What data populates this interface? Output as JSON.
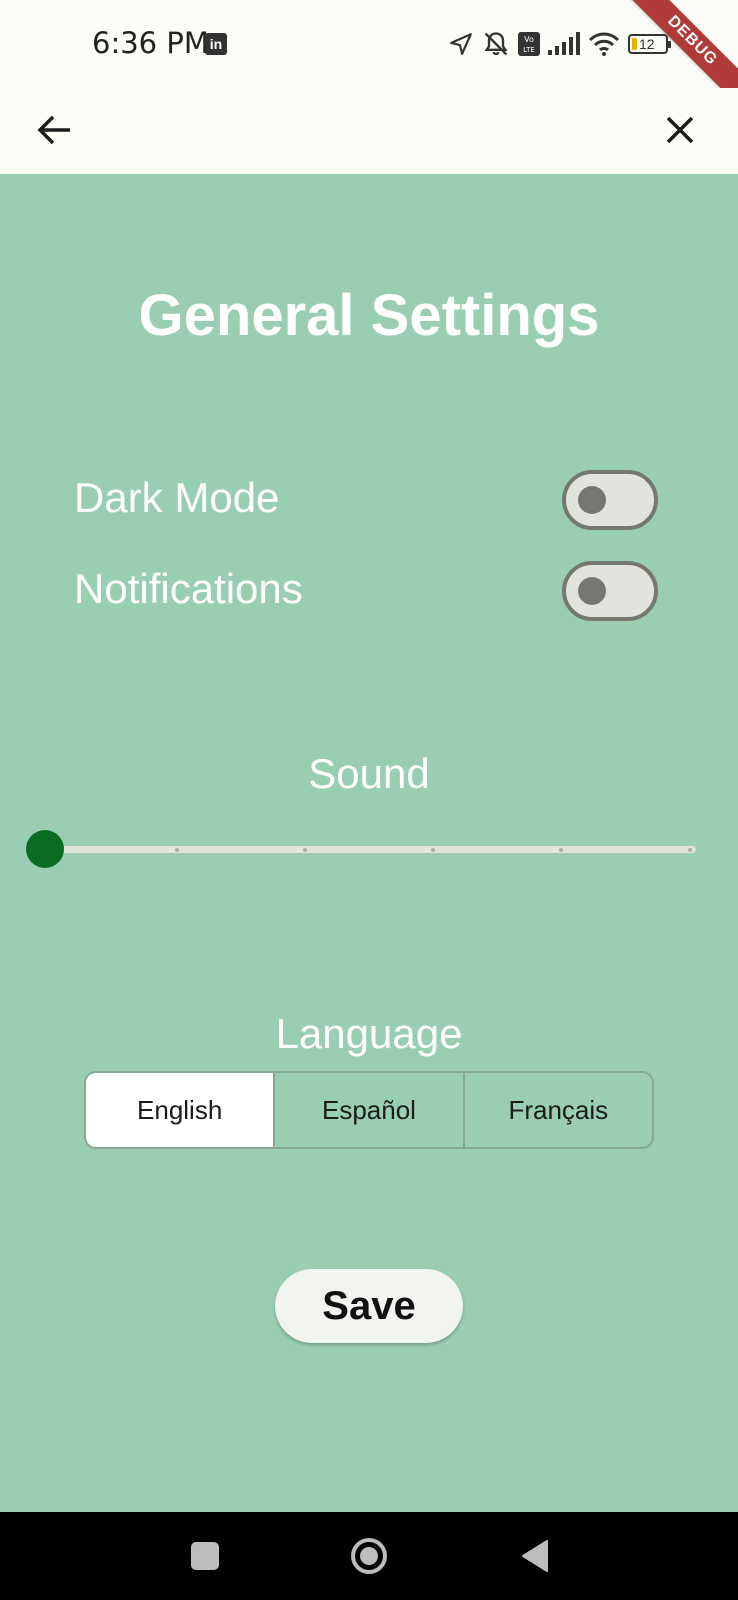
{
  "status_bar": {
    "time": "6:36 PM",
    "linkedin_icon_label": "in",
    "battery_level": "12",
    "icons": [
      "linkedin-icon",
      "location-arrow-icon",
      "notifications-off-icon",
      "volte-icon",
      "signal-icon",
      "wifi-icon",
      "battery-icon"
    ]
  },
  "debug_banner": "DEBUG",
  "app_bar": {
    "back_icon": "arrow-back-icon",
    "close_icon": "close-icon"
  },
  "page": {
    "title": "General Settings"
  },
  "settings": {
    "dark_mode": {
      "label": "Dark Mode",
      "enabled": false
    },
    "notifications": {
      "label": "Notifications",
      "enabled": false
    }
  },
  "sound": {
    "label": "Sound",
    "value": 0,
    "min": 0,
    "max": 5,
    "divisions": 5
  },
  "language": {
    "label": "Language",
    "options": [
      "English",
      "Español",
      "Français"
    ],
    "selected": "English"
  },
  "save_label": "Save",
  "colors": {
    "background": "#9ACEB3",
    "bar_background": "#FCFDF6",
    "accent": "#0A6B23",
    "debug_ribbon": "#B03A3A"
  },
  "nav_bar": {
    "icons": [
      "recents-square-icon",
      "home-circle-icon",
      "back-triangle-icon"
    ]
  }
}
